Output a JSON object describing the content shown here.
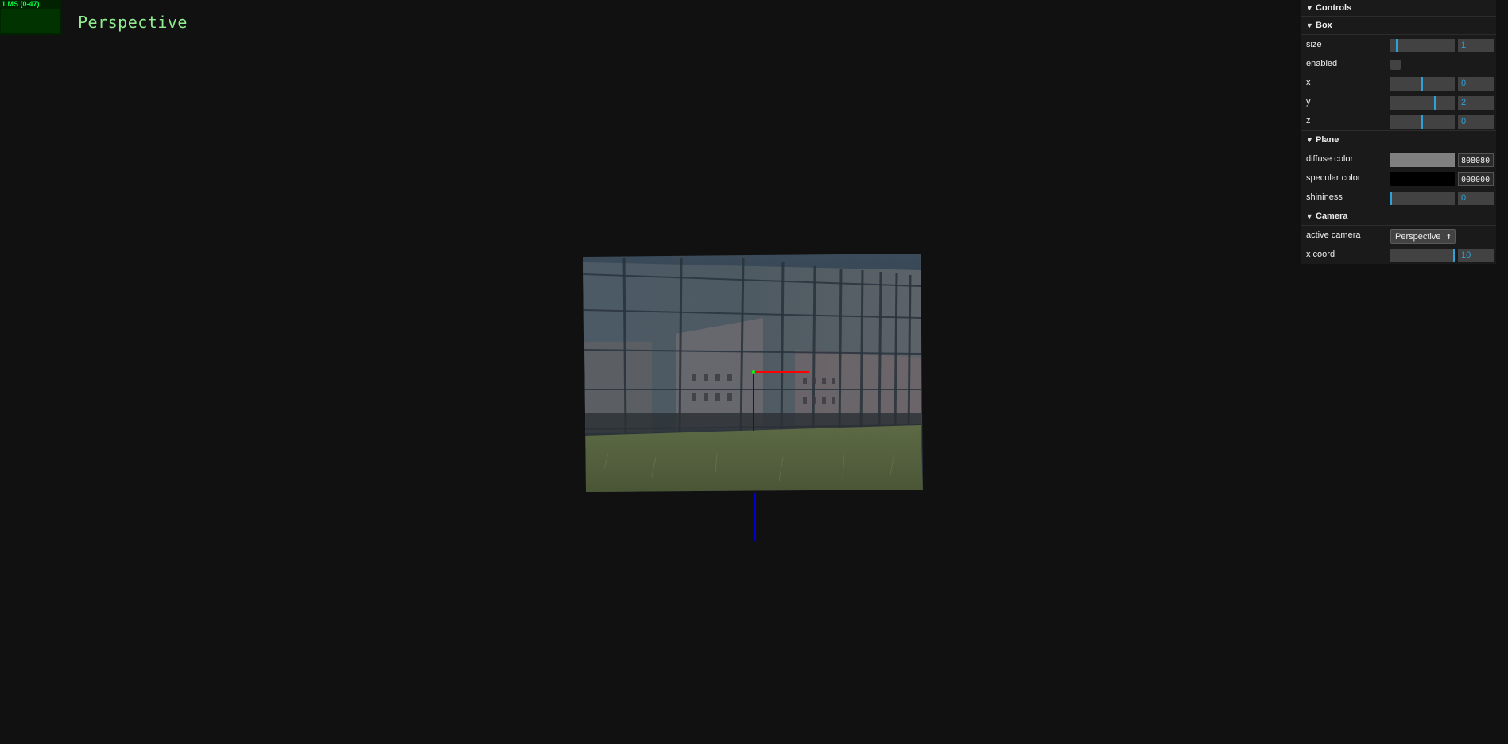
{
  "stats": {
    "label": "1 MS (0-47)"
  },
  "viewport": {
    "title": "Perspective"
  },
  "gui": {
    "header": "Controls",
    "box": {
      "title": "Box",
      "size": {
        "label": "size",
        "value": "1",
        "fraction": 0.08
      },
      "enabled": {
        "label": "enabled",
        "checked": false
      },
      "x": {
        "label": "x",
        "value": "0",
        "fraction": 0.5
      },
      "y": {
        "label": "y",
        "value": "2",
        "fraction": 0.7
      },
      "z": {
        "label": "z",
        "value": "0",
        "fraction": 0.5
      }
    },
    "plane": {
      "title": "Plane",
      "diffuse": {
        "label": "diffuse color",
        "hex": "808080",
        "color": "#808080"
      },
      "specular": {
        "label": "specular color",
        "hex": "000000",
        "color": "#000000"
      },
      "shininess": {
        "label": "shininess",
        "value": "0",
        "fraction": 0.0
      }
    },
    "camera": {
      "title": "Camera",
      "active": {
        "label": "active camera",
        "value": "Perspective"
      },
      "xcoord": {
        "label": "x coord",
        "value": "10",
        "fraction": 1.0
      }
    }
  },
  "colors": {
    "accent": "#2fa1d6",
    "axis_x": "#ff0000",
    "axis_y": "#00ff00",
    "axis_z": "#0000ff"
  }
}
